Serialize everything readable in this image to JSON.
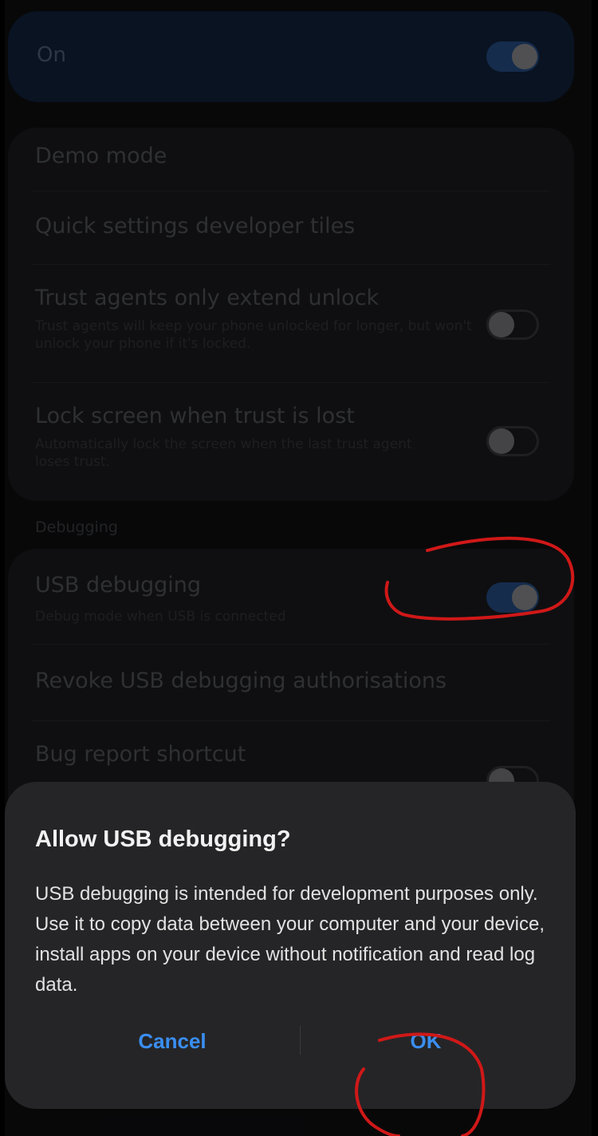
{
  "master": {
    "label": "On",
    "on": true
  },
  "settings": {
    "demo_mode": "Demo mode",
    "qs_tiles": "Quick settings developer tiles",
    "trust_agents": {
      "title": "Trust agents only extend unlock",
      "subtitle": "Trust agents will keep your phone unlocked for longer, but won't unlock your phone if it's locked.",
      "on": false
    },
    "lock_screen": {
      "title": "Lock screen when trust is lost",
      "subtitle": "Automatically lock the screen when the last trust agent loses trust.",
      "on": false
    }
  },
  "debugging": {
    "section_label": "Debugging",
    "usb_debugging": {
      "title": "USB debugging",
      "subtitle": "Debug mode when USB is connected",
      "on": true
    },
    "revoke": "Revoke USB debugging authorisations",
    "bug_report": {
      "title": "Bug report shortcut",
      "on": false
    }
  },
  "dialog": {
    "title": "Allow USB debugging?",
    "body": "USB debugging is intended for development purposes only. Use it to copy data between your computer and your device, install apps on your device without notification and read log data.",
    "cancel_label": "Cancel",
    "ok_label": "OK"
  },
  "colors": {
    "accent": "#3a8ef0",
    "annotation": "#d01818"
  }
}
